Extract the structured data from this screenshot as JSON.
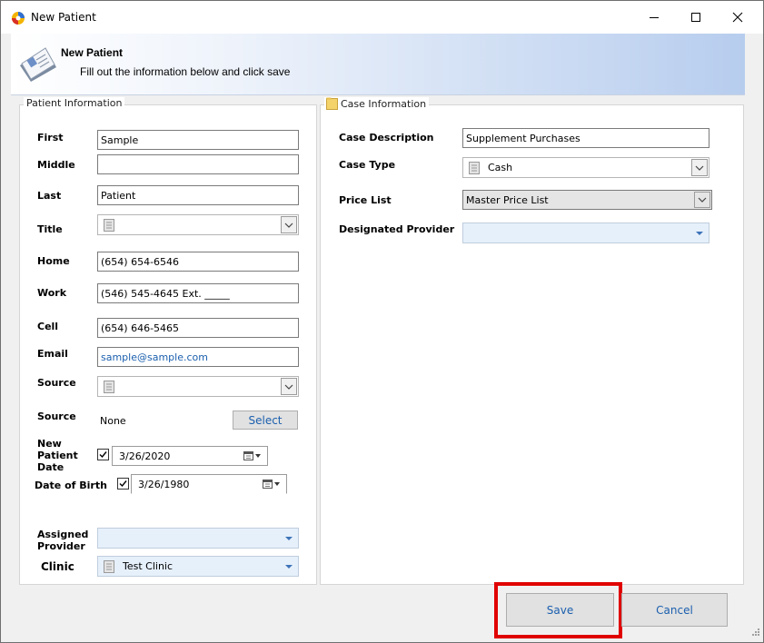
{
  "window": {
    "title": "New Patient"
  },
  "banner": {
    "title": "New Patient",
    "subtitle": "Fill out the information below and click save"
  },
  "patient_info": {
    "legend": "Patient Information",
    "first_label": "First",
    "first_value": "Sample",
    "middle_label": "Middle",
    "middle_value": "",
    "last_label": "Last",
    "last_value": "Patient",
    "title_label": "Title",
    "title_value": "",
    "home_label": "Home",
    "home_value": "(654) 654-6546",
    "work_label": "Work",
    "work_value": "(546) 545-4645 Ext. _____",
    "cell_label": "Cell",
    "cell_value": "(654) 646-5465",
    "email_label": "Email",
    "email_value": "sample@sample.com",
    "source_label": "Source",
    "source_value": "",
    "source2_label": "Source",
    "source2_value": "None",
    "select_button": "Select",
    "new_patient_date_label_1": "New",
    "new_patient_date_label_2": "Patient",
    "new_patient_date_label_3": "Date",
    "new_patient_date_checked": true,
    "new_patient_date_value": "3/26/2020",
    "dob_label": "Date of Birth",
    "dob_checked": true,
    "dob_value": "3/26/1980",
    "assigned_provider_label_1": "Assigned",
    "assigned_provider_label_2": "Provider",
    "assigned_provider_value": "",
    "clinic_label": "Clinic",
    "clinic_value": "Test Clinic"
  },
  "case_info": {
    "legend": "Case Information",
    "description_label": "Case Description",
    "description_value": "Supplement Purchases",
    "case_type_label": "Case Type",
    "case_type_value": "Cash",
    "price_list_label": "Price List",
    "price_list_value": "Master Price List",
    "designated_provider_label": "Designated Provider",
    "designated_provider_value": ""
  },
  "footer": {
    "save_label": "Save",
    "cancel_label": "Cancel"
  },
  "colors": {
    "accent_blue": "#1b5fae",
    "highlight_red": "#e00000",
    "banner_gradient_end": "#b7cdee"
  }
}
